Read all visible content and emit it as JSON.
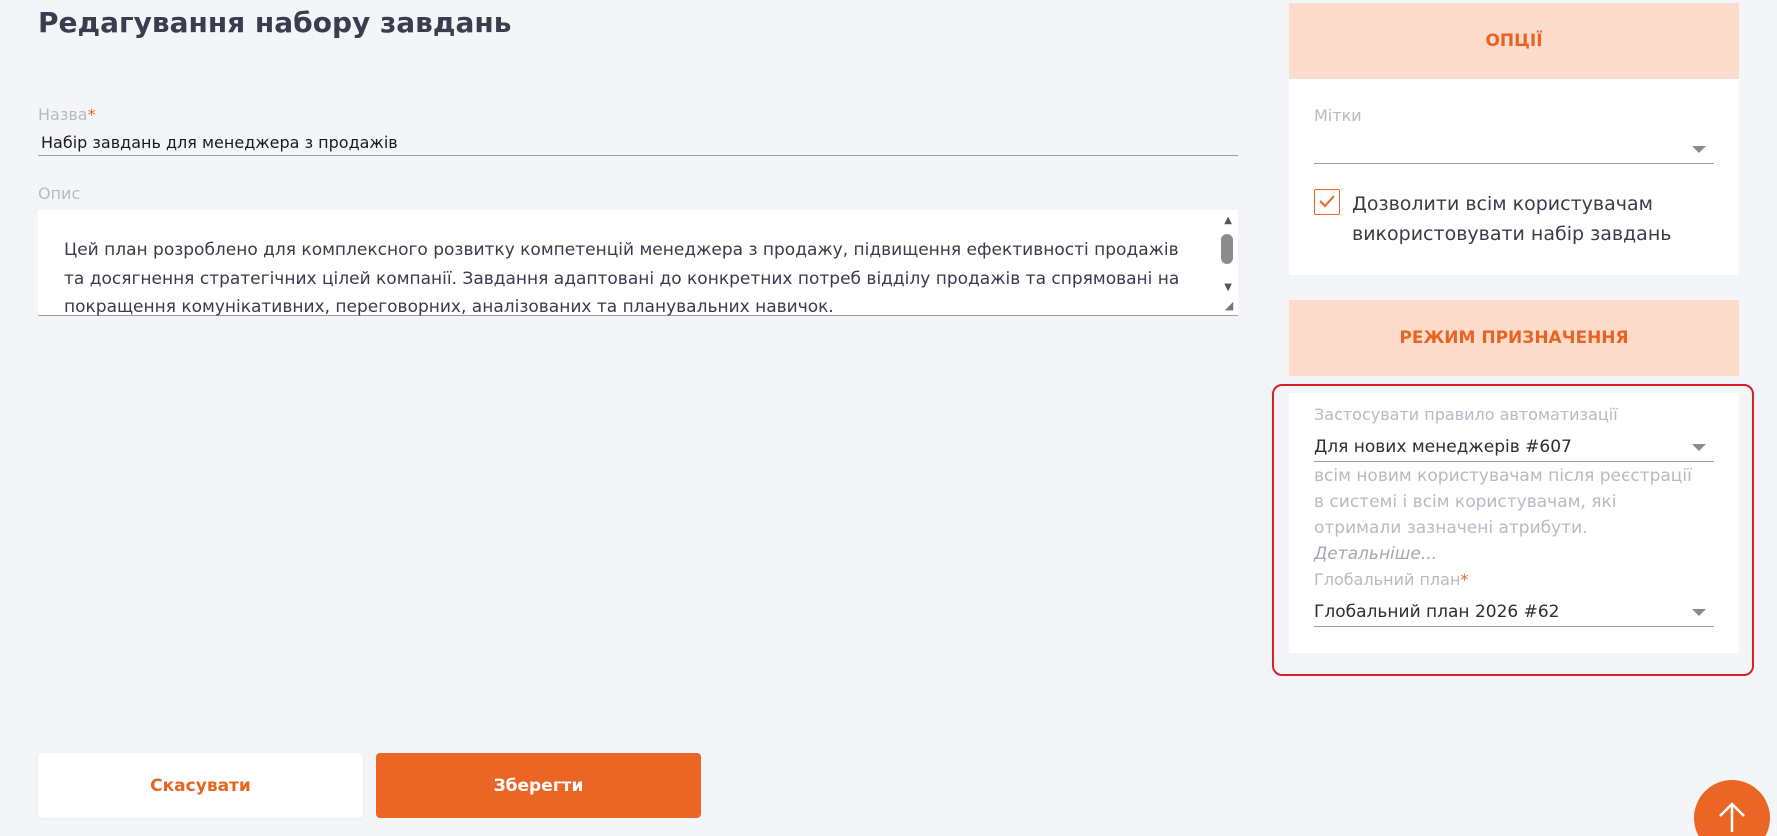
{
  "page": {
    "title": "Редагування набору завдань"
  },
  "form": {
    "name": {
      "label": "Назва",
      "required_mark": "*",
      "value": "Набір завдань для менеджера з продажів"
    },
    "description": {
      "label": "Опис",
      "value": "Цей план розроблено для комплексного розвитку компетенцій менеджера з продажу, підвищення ефективності продажів та досягнення стратегічних цілей компанії. Завдання адаптовані до конкретних потреб відділу продажів та спрямовані на покращення комунікативних, переговорних, аналізованих та планувальних навичок."
    }
  },
  "options_panel": {
    "header": "ОПЦІЇ",
    "tags": {
      "label": "Мітки",
      "value": ""
    },
    "allow_all": {
      "checked": true,
      "label": "Дозволити всім користувачам використовувати набір завдань"
    }
  },
  "assignment_panel": {
    "header": "РЕЖИМ ПРИЗНАЧЕННЯ",
    "automation_rule": {
      "label": "Застосувати правило автоматизації",
      "value": "Для нових менеджерів #607",
      "hint": "всім новим користувачам після реєстрації в системі  і всім користувачам, які отримали зазначені атрибути.",
      "details_link": "Детальніше..."
    },
    "global_plan": {
      "label": "Глобальний план",
      "required_mark": "*",
      "value": "Глобальний план 2026 #62"
    }
  },
  "actions": {
    "cancel_label": "Скасувати",
    "save_label": "Зберегти"
  },
  "colors": {
    "accent": "#eb6625",
    "panel_header_bg": "#fedccb",
    "highlight": "#d8202a"
  },
  "icons": {
    "fab": "arrow-up-icon",
    "checkbox": "checkmark-icon",
    "dropdown": "chevron-down-icon"
  }
}
